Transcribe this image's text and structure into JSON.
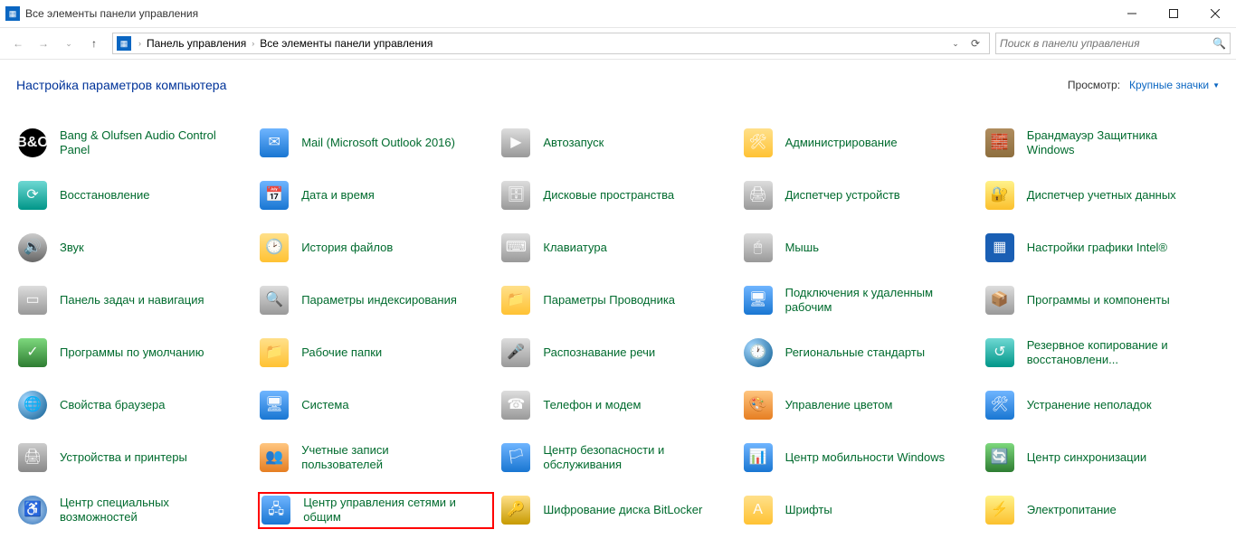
{
  "window": {
    "title": "Все элементы панели управления"
  },
  "breadcrumb": {
    "item1": "Панель управления",
    "item2": "Все элементы панели управления"
  },
  "search": {
    "placeholder": "Поиск в панели управления"
  },
  "header": {
    "heading": "Настройка параметров компьютера",
    "view_label": "Просмотр:",
    "view_value": "Крупные значки"
  },
  "items": [
    {
      "label": "Bang & Olufsen Audio Control Panel",
      "icon": "ic-bo",
      "glyph": "B&O"
    },
    {
      "label": "Mail (Microsoft Outlook 2016)",
      "icon": "ic-blue",
      "glyph": "✉"
    },
    {
      "label": "Автозапуск",
      "icon": "ic-gray",
      "glyph": "▶"
    },
    {
      "label": "Администрирование",
      "icon": "ic-folder",
      "glyph": "🛠"
    },
    {
      "label": "Брандмауэр Защитника Windows",
      "icon": "ic-shield",
      "glyph": "🧱"
    },
    {
      "label": "Восстановление",
      "icon": "ic-teal",
      "glyph": "⟳"
    },
    {
      "label": "Дата и время",
      "icon": "ic-blue",
      "glyph": "📅"
    },
    {
      "label": "Дисковые пространства",
      "icon": "ic-gray",
      "glyph": "🗄"
    },
    {
      "label": "Диспетчер устройств",
      "icon": "ic-gray",
      "glyph": "🖨"
    },
    {
      "label": "Диспетчер учетных данных",
      "icon": "ic-yellow",
      "glyph": "🔐"
    },
    {
      "label": "Звук",
      "icon": "ic-speaker",
      "glyph": "🔊"
    },
    {
      "label": "История файлов",
      "icon": "ic-folder",
      "glyph": "🕑"
    },
    {
      "label": "Клавиатура",
      "icon": "ic-gray",
      "glyph": "⌨"
    },
    {
      "label": "Мышь",
      "icon": "ic-gray",
      "glyph": "🖱"
    },
    {
      "label": "Настройки графики Intel®",
      "icon": "ic-intel",
      "glyph": "▦"
    },
    {
      "label": "Панель задач и навигация",
      "icon": "ic-gray",
      "glyph": "▭"
    },
    {
      "label": "Параметры индексирования",
      "icon": "ic-gray",
      "glyph": "🔍"
    },
    {
      "label": "Параметры Проводника",
      "icon": "ic-folder",
      "glyph": "📁"
    },
    {
      "label": "Подключения к удаленным рабочим",
      "icon": "ic-blue",
      "glyph": "🖥"
    },
    {
      "label": "Программы и компоненты",
      "icon": "ic-gray",
      "glyph": "📦"
    },
    {
      "label": "Программы по умолчанию",
      "icon": "ic-green",
      "glyph": "✓"
    },
    {
      "label": "Рабочие папки",
      "icon": "ic-folder",
      "glyph": "📁"
    },
    {
      "label": "Распознавание речи",
      "icon": "ic-gray",
      "glyph": "🎤"
    },
    {
      "label": "Региональные стандарты",
      "icon": "ic-globe",
      "glyph": "🕐"
    },
    {
      "label": "Резервное копирование и восстановлени...",
      "icon": "ic-teal",
      "glyph": "↺"
    },
    {
      "label": "Свойства браузера",
      "icon": "ic-globe",
      "glyph": "🌐"
    },
    {
      "label": "Система",
      "icon": "ic-blue",
      "glyph": "🖥"
    },
    {
      "label": "Телефон и модем",
      "icon": "ic-gray",
      "glyph": "☎"
    },
    {
      "label": "Управление цветом",
      "icon": "ic-orange",
      "glyph": "🎨"
    },
    {
      "label": "Устранение неполадок",
      "icon": "ic-blue",
      "glyph": "🛠"
    },
    {
      "label": "Устройства и принтеры",
      "icon": "ic-printer",
      "glyph": "🖨"
    },
    {
      "label": "Учетные записи пользователей",
      "icon": "ic-orange",
      "glyph": "👥"
    },
    {
      "label": "Центр безопасности и обслуживания",
      "icon": "ic-blue",
      "glyph": "🏳"
    },
    {
      "label": "Центр мобильности Windows",
      "icon": "ic-blue",
      "glyph": "📊"
    },
    {
      "label": "Центр синхронизации",
      "icon": "ic-green",
      "glyph": "🔄"
    },
    {
      "label": "Центр специальных возможностей",
      "icon": "ic-clock",
      "glyph": "♿"
    },
    {
      "label": "Центр управления сетями и общим",
      "icon": "ic-blue",
      "glyph": "🖧",
      "highlighted": true
    },
    {
      "label": "Шифрование диска BitLocker",
      "icon": "ic-key",
      "glyph": "🔑"
    },
    {
      "label": "Шрифты",
      "icon": "ic-font",
      "glyph": "A"
    },
    {
      "label": "Электропитание",
      "icon": "ic-yellow",
      "glyph": "⚡"
    }
  ]
}
